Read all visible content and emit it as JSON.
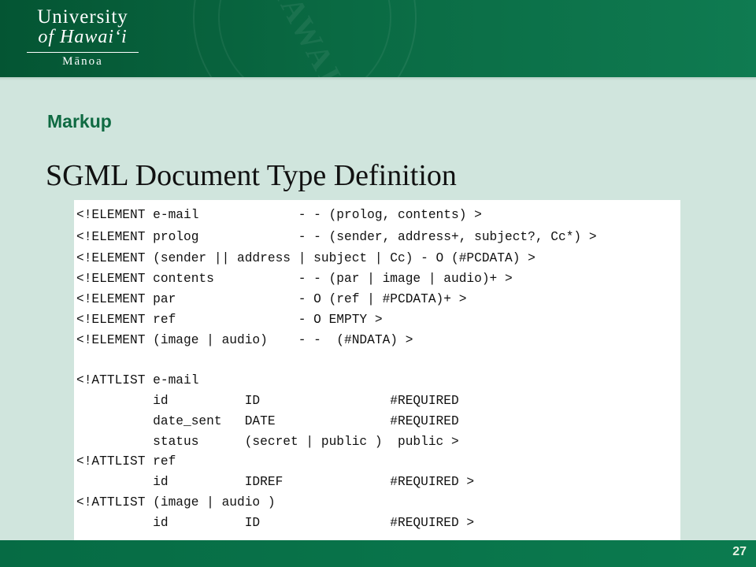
{
  "header": {
    "logo": {
      "line1": "University",
      "line2": "of Hawaiʻi",
      "line3": "Mānoa"
    }
  },
  "slide": {
    "section_title": "Markup",
    "title": "SGML Document Type Definition",
    "code_lines": [
      "<!ELEMENT e-mail             - - (prolog, contents) >",
      "<!ELEMENT prolog             - - (sender, address+, subject?, Cc*) >",
      "<!ELEMENT (sender || address | subject | Cc) - O (#PCDATA) >",
      "<!ELEMENT contents           - - (par | image | audio)+ >",
      "<!ELEMENT par                - O (ref | #PCDATA)+ >",
      "<!ELEMENT ref                - O EMPTY >",
      "<!ELEMENT (image | audio)    - -  (#NDATA) >",
      "",
      "<!ATTLIST e-mail",
      "          id          ID                 #REQUIRED",
      "          date_sent   DATE               #REQUIRED",
      "          status      (secret | public )  public >",
      "<!ATTLIST ref",
      "          id          IDREF              #REQUIRED >",
      "<!ATTLIST (image | audio )",
      "          id          ID                 #REQUIRED >"
    ]
  },
  "footer": {
    "page_number": "27"
  },
  "colors": {
    "header_green": "#045533",
    "title_green": "#0f6a42",
    "background": "#d0e5dd"
  }
}
